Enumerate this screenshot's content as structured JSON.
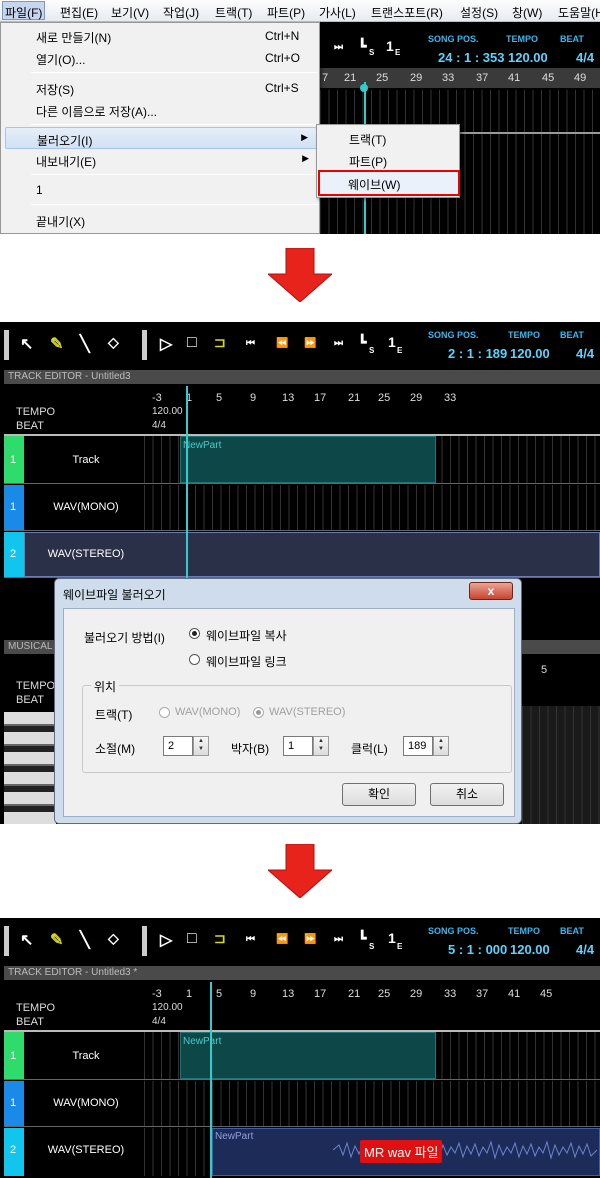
{
  "menubar": {
    "items": [
      "파일(F)",
      "편집(E)",
      "보기(V)",
      "작업(J)",
      "트랙(T)",
      "파트(P)",
      "가사(L)",
      "트랜스포트(R)",
      "설정(S)",
      "창(W)",
      "도움말(H)"
    ]
  },
  "file_menu": {
    "new": {
      "label": "새로 만들기(N)",
      "shortcut": "Ctrl+N"
    },
    "open": {
      "label": "열기(O)...",
      "shortcut": "Ctrl+O"
    },
    "save": {
      "label": "저장(S)",
      "shortcut": "Ctrl+S"
    },
    "save_as": {
      "label": "다른 이름으로 저장(A)..."
    },
    "import": {
      "label": "불러오기(I)"
    },
    "export": {
      "label": "내보내기(E)"
    },
    "recent": {
      "label": "1"
    },
    "exit": {
      "label": "끝내기(X)"
    }
  },
  "import_submenu": {
    "track": "트랙(T)",
    "part": "파트(P)",
    "wave": "웨이브(W)"
  },
  "transport": {
    "song_pos_label": "SONG POS.",
    "tempo_label": "TEMPO",
    "beat_label": "BEAT",
    "s_marker": "S",
    "e_marker": "E"
  },
  "panel1": {
    "song_pos": "24 : 1 : 353",
    "tempo": "120.00",
    "beat": "4/4",
    "ruler": [
      "7",
      "21",
      "25",
      "29",
      "33",
      "37",
      "41",
      "45",
      "49"
    ]
  },
  "panel2": {
    "editor_title": "TRACK EDITOR - Untitled3",
    "song_pos": "2 : 1 : 189",
    "tempo": "120.00",
    "beat": "4/4",
    "ruler": [
      "-3",
      "1",
      "5",
      "9",
      "13",
      "17",
      "21",
      "25",
      "29",
      "33"
    ],
    "tempo_row": {
      "label": "TEMPO",
      "value": "120.00"
    },
    "beat_row": {
      "label": "BEAT",
      "value": "4/4"
    },
    "tracks": [
      {
        "num": "1",
        "name": "Track",
        "color": "#2fdb6a"
      },
      {
        "num": "1",
        "name": "WAV(MONO)",
        "color": "#1a8ae8"
      },
      {
        "num": "2",
        "name": "WAV(STEREO)",
        "color": "#12c5ee"
      }
    ],
    "part_label": "NewPart",
    "part_r": "R",
    "musical_label": "MUSICAL",
    "lower_tempo": "TEMPO",
    "lower_beat": "BEAT",
    "lower_ruler": "5"
  },
  "dialog": {
    "title": "웨이브파일 불러오기",
    "close": "x",
    "method_label": "불러오기 방법(I)",
    "opt_copy": "웨이브파일 복사",
    "opt_link": "웨이브파일 링크",
    "position_group": "위치",
    "track_label": "트랙(T)",
    "track_mono": "WAV(MONO)",
    "track_stereo": "WAV(STEREO)",
    "bar_label": "소절(M)",
    "bar_value": "2",
    "beat_label": "박자(B)",
    "beat_value": "1",
    "tick_label": "클럭(L)",
    "tick_value": "189",
    "ok": "확인",
    "cancel": "취소"
  },
  "panel3": {
    "editor_title": "TRACK EDITOR - Untitled3 *",
    "song_pos": "5 : 1 : 000",
    "tempo": "120.00",
    "beat": "4/4",
    "ruler": [
      "-3",
      "1",
      "5",
      "9",
      "13",
      "17",
      "21",
      "25",
      "29",
      "33",
      "37",
      "41",
      "45"
    ],
    "tempo_row": {
      "label": "TEMPO",
      "value": "120.00"
    },
    "beat_row": {
      "label": "BEAT",
      "value": "4/4"
    },
    "tracks": [
      {
        "num": "1",
        "name": "Track"
      },
      {
        "num": "1",
        "name": "WAV(MONO)"
      },
      {
        "num": "2",
        "name": "WAV(STEREO)"
      }
    ],
    "part_label": "NewPart",
    "wave_part_label": "NewPart",
    "annotation": "MR wav 파일"
  },
  "colors": {
    "accent_red": "#e00000",
    "lcd_cyan": "#5cd3ff",
    "track_green": "#2fdb6a",
    "track_blue": "#1a8ae8",
    "track_cyan": "#12c5ee"
  }
}
